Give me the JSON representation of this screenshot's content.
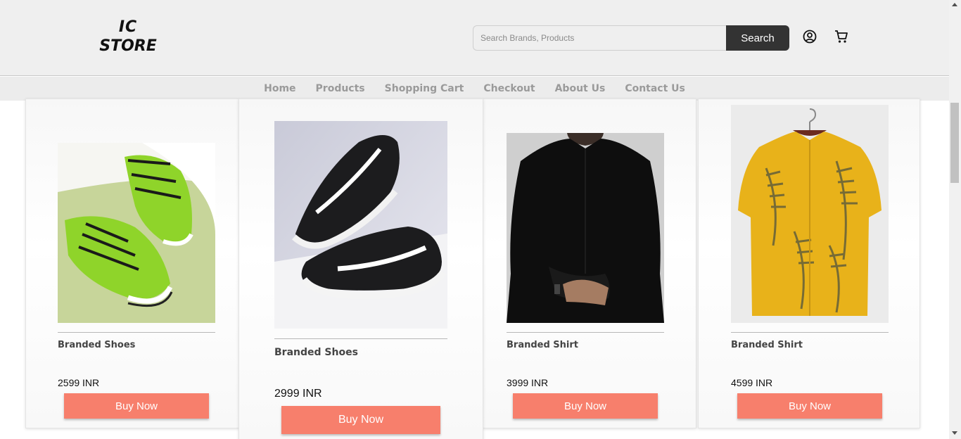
{
  "brand": {
    "line1": "IC",
    "line2": "STORE"
  },
  "search": {
    "placeholder": "Search Brands, Products",
    "value": "",
    "button_label": "Search"
  },
  "header_icons": {
    "account": "user-circle-icon",
    "cart": "shopping-cart-icon"
  },
  "nav": {
    "items": [
      "Home",
      "Products",
      "Shopping Cart",
      "Checkout",
      "About Us",
      "Contact Us"
    ]
  },
  "products": [
    {
      "name": "Branded Shoes",
      "price": "2599 INR",
      "buy_label": "Buy Now",
      "image": "green-sneakers-image"
    },
    {
      "name": "Branded Shoes",
      "price": "2999 INR",
      "buy_label": "Buy Now",
      "image": "black-nike-sneakers-image"
    },
    {
      "name": "Branded Shirt",
      "price": "3999 INR",
      "buy_label": "Buy Now",
      "image": "black-shirt-image"
    },
    {
      "name": "Branded Shirt",
      "price": "4599 INR",
      "buy_label": "Buy Now",
      "image": "yellow-leaf-shirt-image"
    }
  ],
  "colors": {
    "accent_button": "#f77f6c",
    "search_button": "#333333",
    "header_bg": "#efefef",
    "nav_text": "#9a9a9a"
  }
}
